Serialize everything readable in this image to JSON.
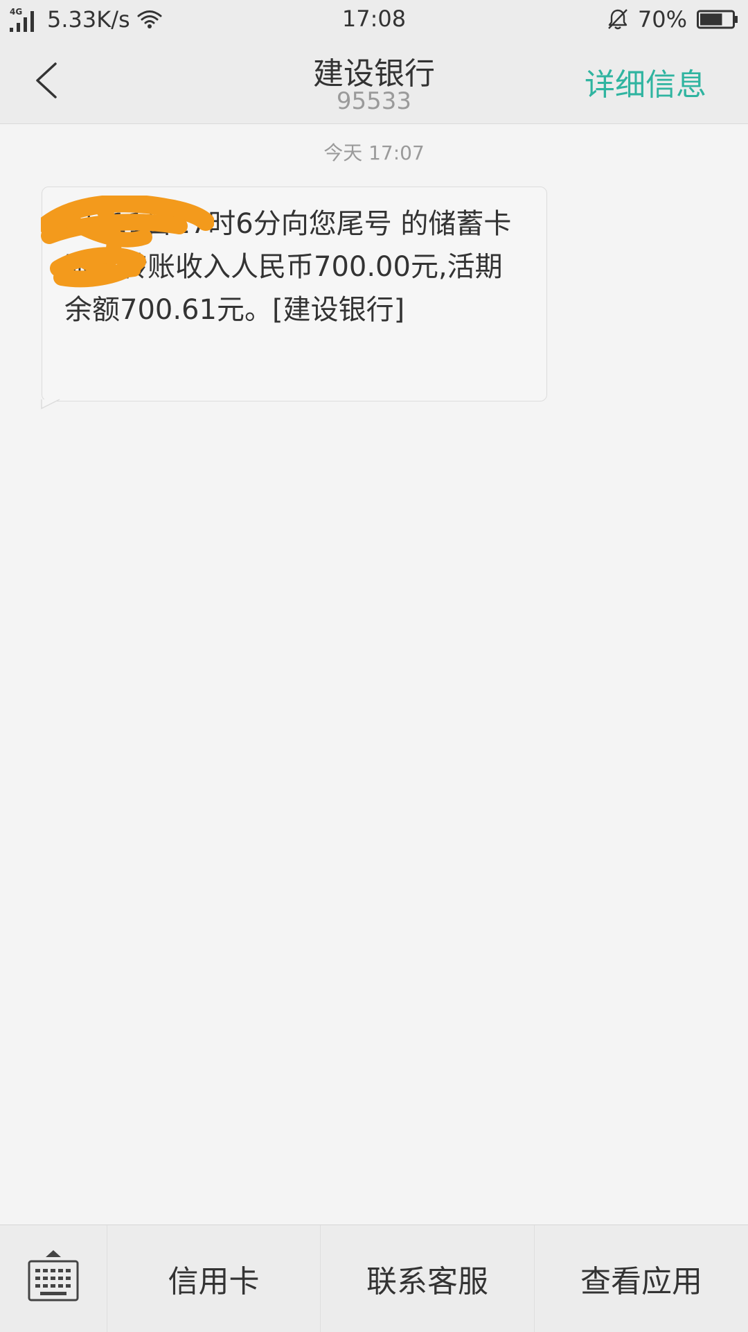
{
  "status_bar": {
    "network_type": "4G",
    "net_speed": "5.33K/s",
    "time": "17:08",
    "battery_percent": "70%",
    "battery_level": 0.7,
    "icons": [
      "signal-icon",
      "wifi-icon",
      "bell-icon",
      "battery-icon"
    ]
  },
  "header": {
    "contact_name": "建设银行",
    "contact_number": "95533",
    "details_label": "详细信息",
    "accent_color": "#2fb4a0",
    "back_icon": "back-arrow-icon"
  },
  "conversation": {
    "timestamp": "今天 17:07",
    "messages": [
      {
        "direction": "incoming",
        "text": "9月11日17时6分向您尾号 的储蓄卡账户转账收入人民币700.00元,活期余额700.61元。[建设银行]",
        "redaction_color": "#f39a1c"
      }
    ]
  },
  "bottom_menu": {
    "keyboard_icon": "keyboard-icon",
    "items": [
      {
        "label": "信用卡"
      },
      {
        "label": "联系客服"
      },
      {
        "label": "查看应用"
      }
    ]
  }
}
